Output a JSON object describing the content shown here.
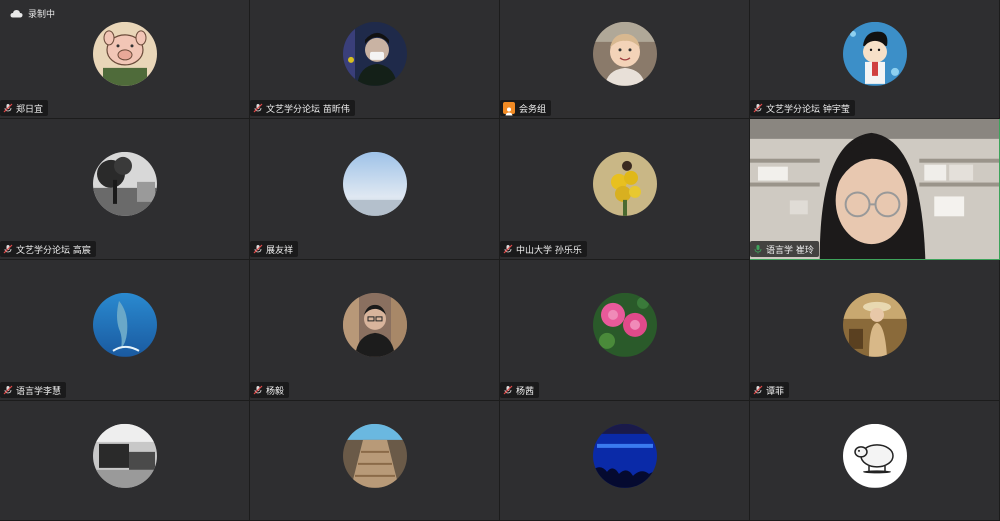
{
  "recording": {
    "label": "录制中"
  },
  "colors": {
    "tile_bg": "#2e2e30",
    "active_border": "#3ea35b",
    "mic_muted": "#e04848",
    "mic_active": "#3ea35b",
    "host_badge": "#f08a24"
  },
  "participants": [
    {
      "name": "郑日宜",
      "avatar": "pig-cartoon-avatar",
      "mic": "muted"
    },
    {
      "name": "文艺学分论坛 苗昕伟",
      "avatar": "masked-person-avatar",
      "mic": "muted"
    },
    {
      "name": "会务组",
      "avatar": "child-photo-avatar",
      "mic": "host"
    },
    {
      "name": "文艺学分论坛 钟宇莹",
      "avatar": "cartoon-boy-avatar",
      "mic": "muted"
    },
    {
      "name": "文艺学分论坛 高宸",
      "avatar": "tree-bw-avatar",
      "mic": "muted"
    },
    {
      "name": "展友祥",
      "avatar": "sky-avatar",
      "mic": "muted"
    },
    {
      "name": "中山大学   孙乐乐",
      "avatar": "sunflower-avatar",
      "mic": "muted"
    },
    {
      "name": "语言学   崔玲",
      "avatar": "camera-video",
      "mic": "active"
    },
    {
      "name": "语言学李慧",
      "avatar": "dolphin-avatar",
      "mic": "muted"
    },
    {
      "name": "杨毅",
      "avatar": "man-glasses-avatar",
      "mic": "muted"
    },
    {
      "name": "杨茜",
      "avatar": "peony-avatar",
      "mic": "muted"
    },
    {
      "name": "谭菲",
      "avatar": "girl-hat-avatar",
      "mic": "muted"
    },
    {
      "name": "",
      "avatar": "room-avatar",
      "mic": "none"
    },
    {
      "name": "",
      "avatar": "stairs-avatar",
      "mic": "none"
    },
    {
      "name": "",
      "avatar": "blue-concert-avatar",
      "mic": "none"
    },
    {
      "name": "",
      "avatar": "sheep-sketch-avatar",
      "mic": "none"
    }
  ]
}
